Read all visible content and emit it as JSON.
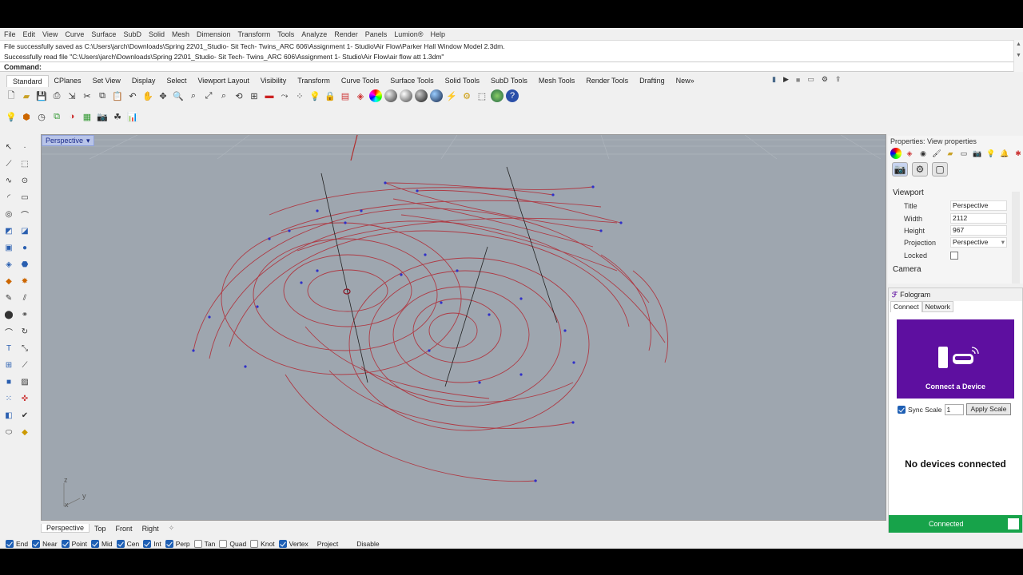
{
  "menu": [
    "File",
    "Edit",
    "View",
    "Curve",
    "Surface",
    "SubD",
    "Solid",
    "Mesh",
    "Dimension",
    "Transform",
    "Tools",
    "Analyze",
    "Render",
    "Panels",
    "Lumion®",
    "Help"
  ],
  "command_history": [
    "File successfully saved as C:\\Users\\jarch\\Downloads\\Spring 22\\01_Studio- Sit Tech- Twins_ARC 606\\Assignment 1- Studio\\Air Flow\\Parker Hall Window Model 2.3dm.",
    "Successfully read file \"C:\\Users\\jarch\\Downloads\\Spring 22\\01_Studio- Sit Tech- Twins_ARC 606\\Assignment 1- Studio\\Air Flow\\air flow att 1.3dm\""
  ],
  "command_prompt": "Command:",
  "toolbar_tabs": [
    "Standard",
    "CPlanes",
    "Set View",
    "Display",
    "Select",
    "Viewport Layout",
    "Visibility",
    "Transform",
    "Curve Tools",
    "Surface Tools",
    "Solid Tools",
    "SubD Tools",
    "Mesh Tools",
    "Render Tools",
    "Drafting",
    "New»"
  ],
  "active_toolbar_tab": "Standard",
  "viewport": {
    "name": "Perspective",
    "axis_labels": {
      "z": "z",
      "y": "y",
      "x": "x"
    },
    "background_color": "#9ea6af",
    "curve_color": "#b0303a"
  },
  "viewport_tabs": [
    "Perspective",
    "Top",
    "Front",
    "Right"
  ],
  "osnaps": [
    {
      "label": "End",
      "checked": true
    },
    {
      "label": "Near",
      "checked": true
    },
    {
      "label": "Point",
      "checked": true
    },
    {
      "label": "Mid",
      "checked": true
    },
    {
      "label": "Cen",
      "checked": true
    },
    {
      "label": "Int",
      "checked": true
    },
    {
      "label": "Perp",
      "checked": true
    },
    {
      "label": "Tan",
      "checked": false
    },
    {
      "label": "Quad",
      "checked": false
    },
    {
      "label": "Knot",
      "checked": false
    },
    {
      "label": "Vertex",
      "checked": true
    },
    {
      "label": "Project",
      "checked": false
    },
    {
      "label": "Disable",
      "checked": false
    }
  ],
  "properties": {
    "title": "Properties: View properties",
    "section_viewport": "Viewport",
    "rows": [
      {
        "label": "Title",
        "value": "Perspective"
      },
      {
        "label": "Width",
        "value": "2112"
      },
      {
        "label": "Height",
        "value": "967"
      },
      {
        "label": "Projection",
        "value": "Perspective"
      },
      {
        "label": "Locked",
        "value": ""
      }
    ],
    "section_camera": "Camera"
  },
  "fologram": {
    "title": "Fologram",
    "tabs": [
      "Connect",
      "Network"
    ],
    "card_caption": "Connect a Device",
    "card_color": "#5e0fa0",
    "sync_label": "Sync Scale",
    "sync_checked": true,
    "scale_value": "1",
    "apply_label": "Apply Scale",
    "no_devices": "No devices connected",
    "status": "Connected",
    "status_color": "#17a34a"
  }
}
